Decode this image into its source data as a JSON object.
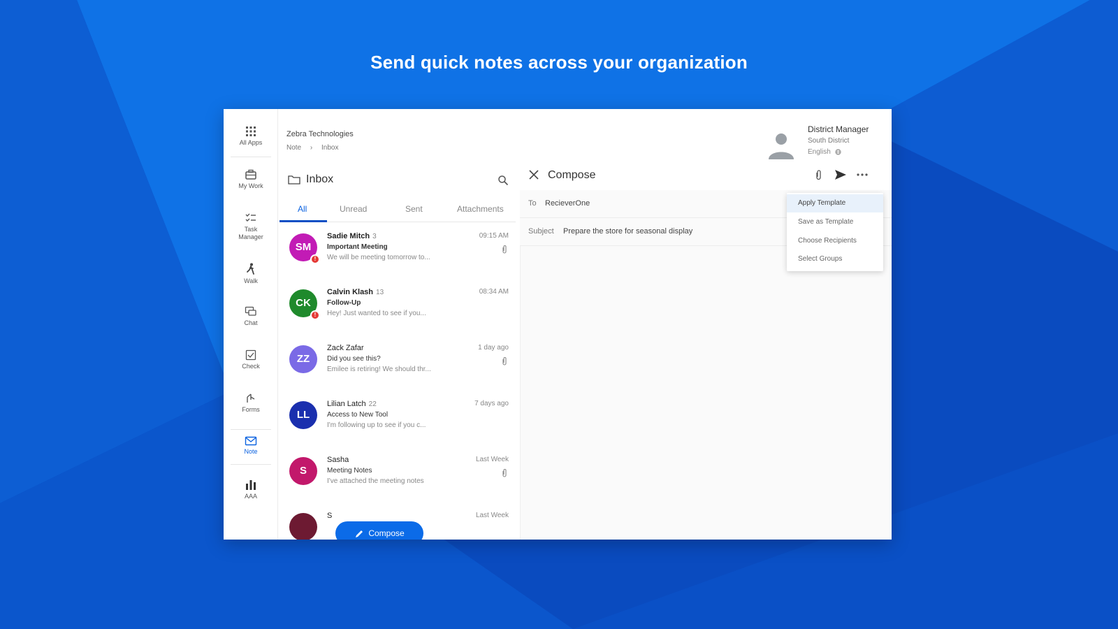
{
  "headline": "Send quick notes across your organization",
  "colors": {
    "accent": "#0b4fc4",
    "button": "#0b6be8",
    "alert": "#e53935"
  },
  "rail": [
    {
      "label": "All Apps",
      "icon": "grid-icon"
    },
    {
      "label": "My Work",
      "icon": "briefcase-icon"
    },
    {
      "label": "Task Manager",
      "icon": "checklist-icon"
    },
    {
      "label": "Walk",
      "icon": "walk-icon"
    },
    {
      "label": "Chat",
      "icon": "chat-icon"
    },
    {
      "label": "Check",
      "icon": "check-icon"
    },
    {
      "label": "Forms",
      "icon": "forms-icon"
    },
    {
      "label": "Note",
      "icon": "mail-icon",
      "active": true
    },
    {
      "label": "AAA",
      "icon": "bar-chart-icon"
    }
  ],
  "breadcrumb": {
    "org": "Zebra Technologies",
    "items": [
      "Note",
      "Inbox"
    ]
  },
  "inbox": {
    "title": "Inbox",
    "tabs": [
      "All",
      "Unread",
      "Sent",
      "Attachments"
    ],
    "messages": [
      {
        "initials": "SM",
        "color": "#c21bb5",
        "sender": "Sadie Mitch",
        "count": "3",
        "subject": "Important Meeting",
        "preview": "We will be meeting tomorrow to...",
        "time": "09:15 AM",
        "unread": true,
        "alert": "!",
        "attachment": true
      },
      {
        "initials": "CK",
        "color": "#1f8a2c",
        "sender": "Calvin Klash",
        "count": "13",
        "subject": "Follow-Up",
        "preview": "Hey! Just wanted to see if you...",
        "time": "08:34 AM",
        "unread": true,
        "alert": "!",
        "attachment": false
      },
      {
        "initials": "ZZ",
        "color": "#7a6ae6",
        "sender": "Zack Zafar",
        "count": "",
        "subject": "Did you see this?",
        "preview": "Emilee is retiring! We should thr...",
        "time": "1 day ago",
        "unread": false,
        "alert": "",
        "attachment": true
      },
      {
        "initials": "LL",
        "color": "#1a2fae",
        "sender": "Lilian Latch",
        "count": "22",
        "subject": "Access to New Tool",
        "preview": "I'm following up to see if you c...",
        "time": "7 days ago",
        "unread": false,
        "alert": "",
        "attachment": false
      },
      {
        "initials": "S",
        "color": "#c2186b",
        "sender": "Sasha",
        "count": "",
        "subject": "Meeting Notes",
        "preview": "I've attached the meeting notes",
        "time": "Last Week",
        "unread": false,
        "alert": "",
        "attachment": true
      },
      {
        "initials": "",
        "color": "#6d1a32",
        "sender": "S",
        "count": "",
        "subject": "",
        "preview": "",
        "time": "Last Week",
        "unread": false,
        "alert": "",
        "attachment": false
      }
    ]
  },
  "compose": {
    "title": "Compose",
    "to_label": "To",
    "to_value": "RecieverOne",
    "subject_label": "Subject",
    "subject_value": "Prepare the store for seasonal display",
    "button_label": "Compose"
  },
  "user": {
    "name": "District Manager",
    "district": "South District",
    "language": "English"
  },
  "menu": [
    "Apply Template",
    "Save as Template",
    "Choose Recipients",
    "Select Groups"
  ]
}
